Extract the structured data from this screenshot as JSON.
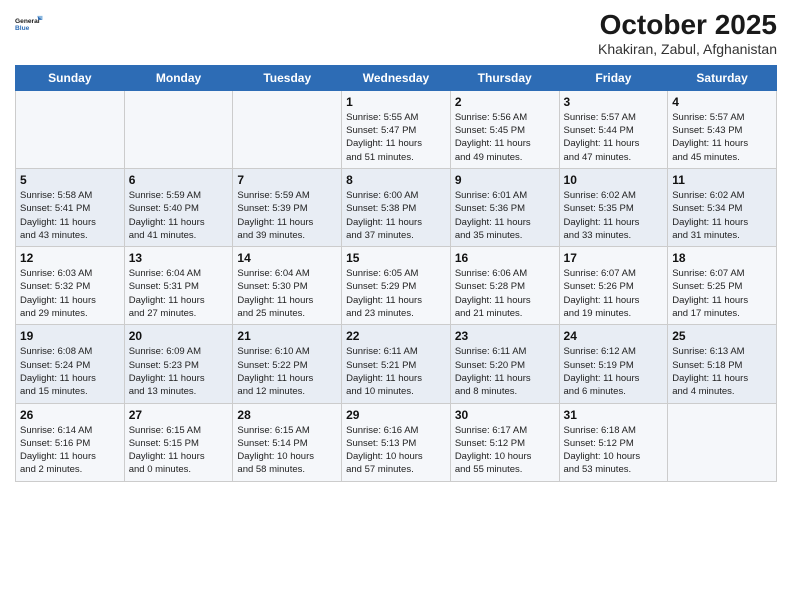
{
  "logo": {
    "line1": "General",
    "line2": "Blue"
  },
  "title": "October 2025",
  "subtitle": "Khakiran, Zabul, Afghanistan",
  "weekdays": [
    "Sunday",
    "Monday",
    "Tuesday",
    "Wednesday",
    "Thursday",
    "Friday",
    "Saturday"
  ],
  "weeks": [
    [
      {
        "day": "",
        "info": ""
      },
      {
        "day": "",
        "info": ""
      },
      {
        "day": "",
        "info": ""
      },
      {
        "day": "1",
        "info": "Sunrise: 5:55 AM\nSunset: 5:47 PM\nDaylight: 11 hours\nand 51 minutes."
      },
      {
        "day": "2",
        "info": "Sunrise: 5:56 AM\nSunset: 5:45 PM\nDaylight: 11 hours\nand 49 minutes."
      },
      {
        "day": "3",
        "info": "Sunrise: 5:57 AM\nSunset: 5:44 PM\nDaylight: 11 hours\nand 47 minutes."
      },
      {
        "day": "4",
        "info": "Sunrise: 5:57 AM\nSunset: 5:43 PM\nDaylight: 11 hours\nand 45 minutes."
      }
    ],
    [
      {
        "day": "5",
        "info": "Sunrise: 5:58 AM\nSunset: 5:41 PM\nDaylight: 11 hours\nand 43 minutes."
      },
      {
        "day": "6",
        "info": "Sunrise: 5:59 AM\nSunset: 5:40 PM\nDaylight: 11 hours\nand 41 minutes."
      },
      {
        "day": "7",
        "info": "Sunrise: 5:59 AM\nSunset: 5:39 PM\nDaylight: 11 hours\nand 39 minutes."
      },
      {
        "day": "8",
        "info": "Sunrise: 6:00 AM\nSunset: 5:38 PM\nDaylight: 11 hours\nand 37 minutes."
      },
      {
        "day": "9",
        "info": "Sunrise: 6:01 AM\nSunset: 5:36 PM\nDaylight: 11 hours\nand 35 minutes."
      },
      {
        "day": "10",
        "info": "Sunrise: 6:02 AM\nSunset: 5:35 PM\nDaylight: 11 hours\nand 33 minutes."
      },
      {
        "day": "11",
        "info": "Sunrise: 6:02 AM\nSunset: 5:34 PM\nDaylight: 11 hours\nand 31 minutes."
      }
    ],
    [
      {
        "day": "12",
        "info": "Sunrise: 6:03 AM\nSunset: 5:32 PM\nDaylight: 11 hours\nand 29 minutes."
      },
      {
        "day": "13",
        "info": "Sunrise: 6:04 AM\nSunset: 5:31 PM\nDaylight: 11 hours\nand 27 minutes."
      },
      {
        "day": "14",
        "info": "Sunrise: 6:04 AM\nSunset: 5:30 PM\nDaylight: 11 hours\nand 25 minutes."
      },
      {
        "day": "15",
        "info": "Sunrise: 6:05 AM\nSunset: 5:29 PM\nDaylight: 11 hours\nand 23 minutes."
      },
      {
        "day": "16",
        "info": "Sunrise: 6:06 AM\nSunset: 5:28 PM\nDaylight: 11 hours\nand 21 minutes."
      },
      {
        "day": "17",
        "info": "Sunrise: 6:07 AM\nSunset: 5:26 PM\nDaylight: 11 hours\nand 19 minutes."
      },
      {
        "day": "18",
        "info": "Sunrise: 6:07 AM\nSunset: 5:25 PM\nDaylight: 11 hours\nand 17 minutes."
      }
    ],
    [
      {
        "day": "19",
        "info": "Sunrise: 6:08 AM\nSunset: 5:24 PM\nDaylight: 11 hours\nand 15 minutes."
      },
      {
        "day": "20",
        "info": "Sunrise: 6:09 AM\nSunset: 5:23 PM\nDaylight: 11 hours\nand 13 minutes."
      },
      {
        "day": "21",
        "info": "Sunrise: 6:10 AM\nSunset: 5:22 PM\nDaylight: 11 hours\nand 12 minutes."
      },
      {
        "day": "22",
        "info": "Sunrise: 6:11 AM\nSunset: 5:21 PM\nDaylight: 11 hours\nand 10 minutes."
      },
      {
        "day": "23",
        "info": "Sunrise: 6:11 AM\nSunset: 5:20 PM\nDaylight: 11 hours\nand 8 minutes."
      },
      {
        "day": "24",
        "info": "Sunrise: 6:12 AM\nSunset: 5:19 PM\nDaylight: 11 hours\nand 6 minutes."
      },
      {
        "day": "25",
        "info": "Sunrise: 6:13 AM\nSunset: 5:18 PM\nDaylight: 11 hours\nand 4 minutes."
      }
    ],
    [
      {
        "day": "26",
        "info": "Sunrise: 6:14 AM\nSunset: 5:16 PM\nDaylight: 11 hours\nand 2 minutes."
      },
      {
        "day": "27",
        "info": "Sunrise: 6:15 AM\nSunset: 5:15 PM\nDaylight: 11 hours\nand 0 minutes."
      },
      {
        "day": "28",
        "info": "Sunrise: 6:15 AM\nSunset: 5:14 PM\nDaylight: 10 hours\nand 58 minutes."
      },
      {
        "day": "29",
        "info": "Sunrise: 6:16 AM\nSunset: 5:13 PM\nDaylight: 10 hours\nand 57 minutes."
      },
      {
        "day": "30",
        "info": "Sunrise: 6:17 AM\nSunset: 5:12 PM\nDaylight: 10 hours\nand 55 minutes."
      },
      {
        "day": "31",
        "info": "Sunrise: 6:18 AM\nSunset: 5:12 PM\nDaylight: 10 hours\nand 53 minutes."
      },
      {
        "day": "",
        "info": ""
      }
    ]
  ]
}
